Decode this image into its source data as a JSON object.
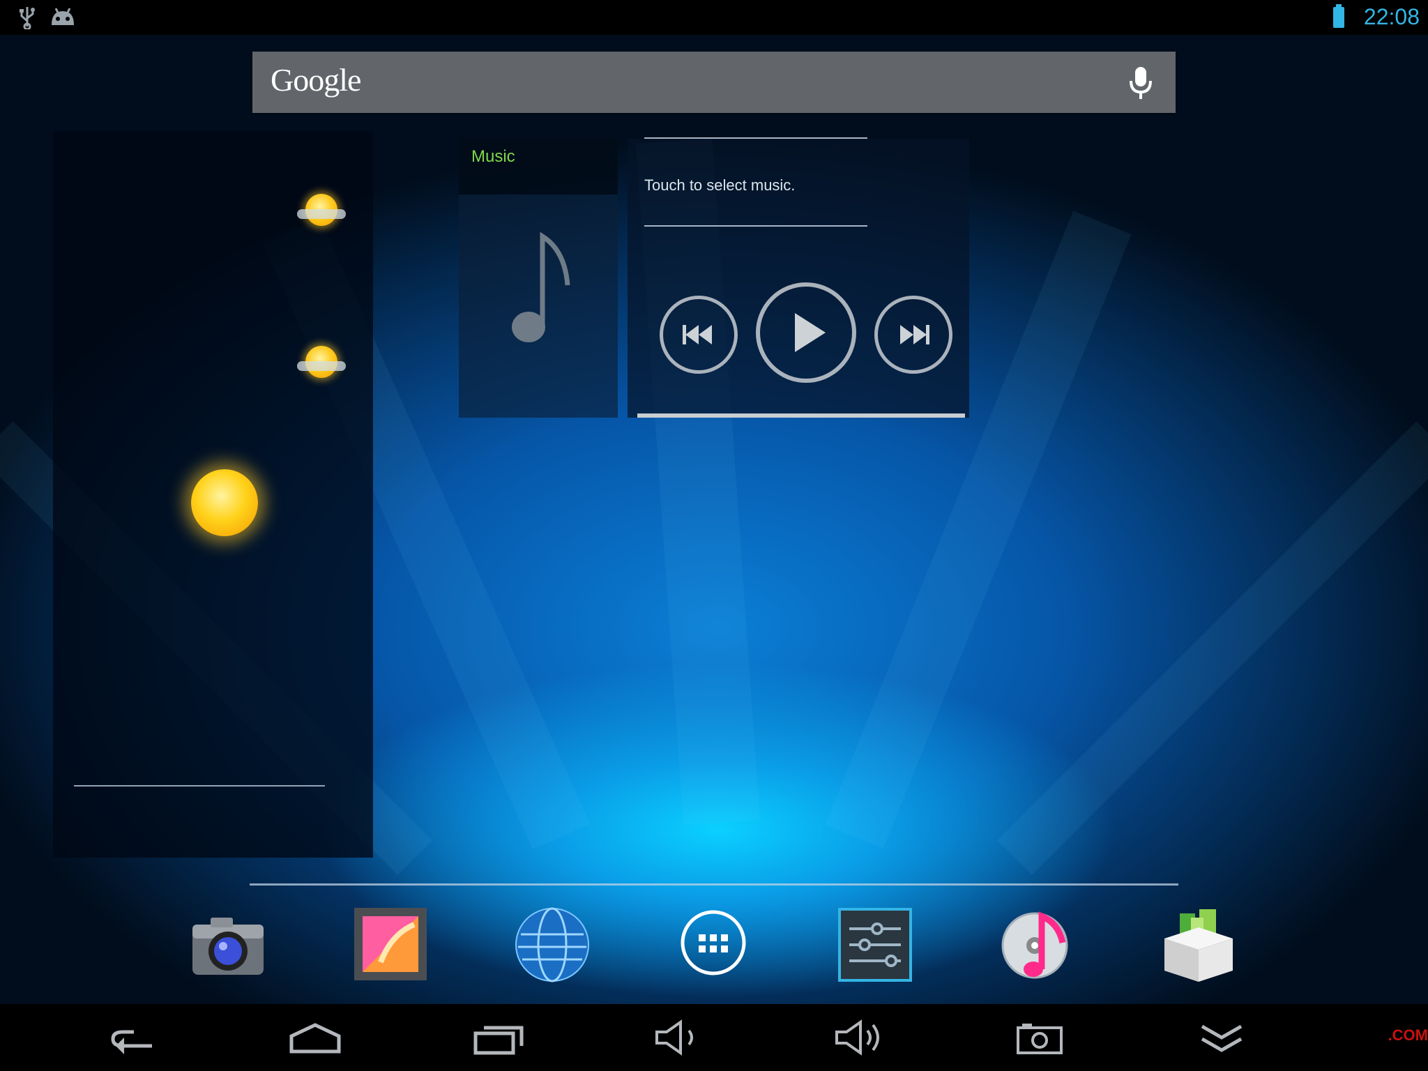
{
  "status_bar": {
    "time": "22:08",
    "icons": [
      "usb-icon",
      "android-debug-icon",
      "battery-icon"
    ],
    "accent": "#33b5e5"
  },
  "search": {
    "logo": "Google",
    "mic_icon": "microphone-icon"
  },
  "weather_widget": {
    "icons": [
      "sun-icon",
      "partly-cloudy-icon",
      "partly-cloudy-icon"
    ]
  },
  "music_widget": {
    "label": "Music",
    "label_color": "#7fd84a",
    "status": "Touch to select music.",
    "controls": [
      "previous-icon",
      "play-icon",
      "next-icon"
    ]
  },
  "dock": {
    "apps": [
      "camera-icon",
      "gallery-icon",
      "browser-icon",
      "all-apps-icon",
      "settings-icon",
      "music-player-icon",
      "app-installer-icon"
    ]
  },
  "nav_bar": {
    "buttons": [
      "back-icon",
      "home-icon",
      "recent-apps-icon",
      "volume-down-icon",
      "volume-up-icon",
      "screenshot-icon",
      "collapse-icon"
    ],
    "watermark": ".COM"
  }
}
